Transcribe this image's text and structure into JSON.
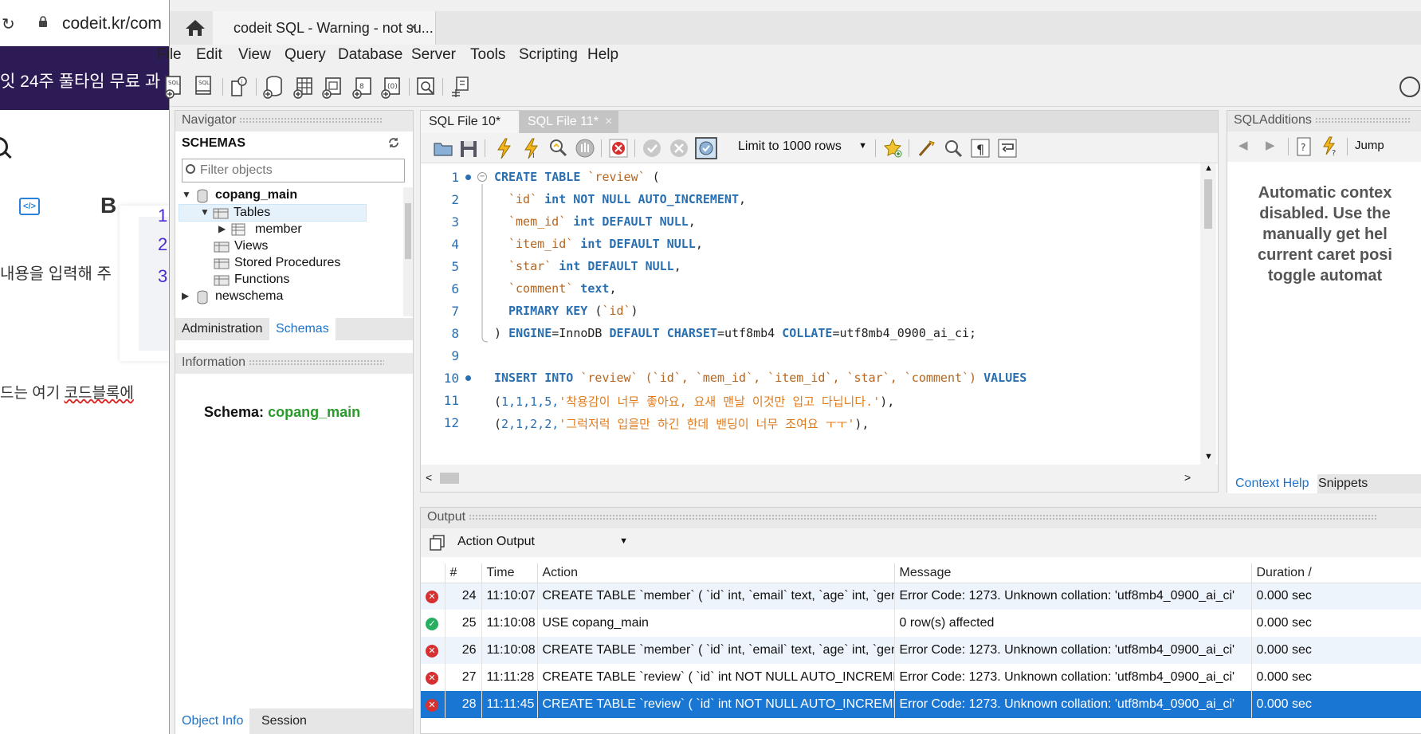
{
  "browser": {
    "url": "codeit.kr/com",
    "banner": "잇 24주 풀타임 무료 과",
    "text1": "내용을 입력해 주",
    "card_numbers": [
      "1",
      "2",
      "3"
    ],
    "text2_plain": "드는 여기 ",
    "text2_underlined": "코드블록에"
  },
  "window": {
    "tab_title": "codeit SQL - Warning - not su...",
    "tab_close": "×"
  },
  "menu": [
    "File",
    "Edit",
    "View",
    "Query",
    "Database",
    "Server",
    "Tools",
    "Scripting",
    "Help"
  ],
  "navigator": {
    "header": "Navigator",
    "schemas_label": "SCHEMAS",
    "filter_placeholder": "Filter objects",
    "tree": {
      "schema1": "copang_main",
      "tables": "Tables",
      "member": "member",
      "views": "Views",
      "procs": "Stored Procedures",
      "funcs": "Functions",
      "schema2": "newschema"
    },
    "tabs": [
      "Administration",
      "Schemas"
    ],
    "info_header": "Information",
    "info_label": "Schema:",
    "info_value": "copang_main",
    "bottom_tabs": [
      "Object Info",
      "Session"
    ]
  },
  "editor": {
    "file_tabs": [
      "SQL File 10*",
      "SQL File 11*"
    ],
    "limit": "Limit to 1000 rows",
    "lines": [
      {
        "n": "1"
      },
      {
        "n": "2"
      },
      {
        "n": "3"
      },
      {
        "n": "4"
      },
      {
        "n": "5"
      },
      {
        "n": "6"
      },
      {
        "n": "7"
      },
      {
        "n": "8"
      },
      {
        "n": "9"
      },
      {
        "n": "10"
      },
      {
        "n": "11"
      },
      {
        "n": "12"
      }
    ],
    "code": {
      "l1_kw": "CREATE TABLE ",
      "l1_id": "`review`",
      "l1_end": " (",
      "l2_id": "`id`",
      "l2_kw": " int NOT NULL AUTO_INCREMENT",
      "l2_end": ",",
      "l3_id": "`mem_id`",
      "l3_kw": " int DEFAULT NULL",
      "l3_end": ",",
      "l4_id": "`item_id`",
      "l4_kw": " int DEFAULT NULL",
      "l4_end": ",",
      "l5_id": "`star`",
      "l5_kw": " int DEFAULT NULL",
      "l5_end": ",",
      "l6_id": "`comment`",
      "l6_kw": " text",
      "l6_end": ",",
      "l7_kw": "PRIMARY KEY ",
      "l7_a": "(",
      "l7_id": "`id`",
      "l7_b": ")",
      "l8_a": ") ",
      "l8_kw1": "ENGINE",
      "l8_b": "=InnoDB ",
      "l8_kw2": "DEFAULT CHARSET",
      "l8_c": "=utf8mb4 ",
      "l8_kw3": "COLLATE",
      "l8_d": "=utf8mb4_0900_ai_ci;",
      "l10_kw": "INSERT INTO ",
      "l10_id": "`review` (`id`, `mem_id`, `item_id`, `star`, `comment`)",
      "l10_kw2": " VALUES",
      "l11_a": "(",
      "l11_nums": "1,1,1,5,",
      "l11_str": "'착용감이 너무 좋아요, 요새 맨날 이것만 입고 다닙니다.'",
      "l11_b": "),",
      "l12_a": "(",
      "l12_nums": "2,1,2,2,",
      "l12_str": "'그럭저럭 입을만 하긴 한데 밴딩이 너무 조여요 ㅜㅜ'",
      "l12_b": "),"
    }
  },
  "additions": {
    "header": "SQLAdditions",
    "jump": "Jump",
    "help_lines": [
      "Automatic contex",
      "disabled. Use the",
      "manually get hel",
      "current caret posi",
      "toggle automat"
    ],
    "tabs": [
      "Context Help",
      "Snippets"
    ]
  },
  "output": {
    "header": "Output",
    "selector": "Action Output",
    "columns": [
      "",
      "#",
      "Time",
      "Action",
      "Message",
      "Duration /"
    ],
    "rows": [
      {
        "status": "error",
        "num": "24",
        "time": "11:10:07",
        "action": "CREATE TABLE `member` (   `id` int,   `email` text,   `age` int,   `gend...",
        "message": "Error Code: 1273. Unknown collation: 'utf8mb4_0900_ai_ci'",
        "duration": "0.000 sec"
      },
      {
        "status": "ok",
        "num": "25",
        "time": "11:10:08",
        "action": "USE copang_main",
        "message": "0 row(s) affected",
        "duration": "0.000 sec"
      },
      {
        "status": "error",
        "num": "26",
        "time": "11:10:08",
        "action": "CREATE TABLE `member` (   `id` int,   `email` text,   `age` int,   `gend...",
        "message": "Error Code: 1273. Unknown collation: 'utf8mb4_0900_ai_ci'",
        "duration": "0.000 sec"
      },
      {
        "status": "error",
        "num": "27",
        "time": "11:11:28",
        "action": "CREATE TABLE `review` (   `id` int NOT NULL AUTO_INCREMEN...",
        "message": "Error Code: 1273. Unknown collation: 'utf8mb4_0900_ai_ci'",
        "duration": "0.000 sec"
      },
      {
        "status": "error",
        "num": "28",
        "time": "11:11:45",
        "action": "CREATE TABLE `review` (   `id` int NOT NULL AUTO_INCREMEN...",
        "message": "Error Code: 1273. Unknown collation: 'utf8mb4_0900_ai_ci'",
        "duration": "0.000 sec"
      }
    ]
  },
  "colors": {
    "keyword": "#2a6fb0",
    "identifier": "#b5651d",
    "string": "#e07a1a",
    "error": "#d63031",
    "ok": "#27ae60",
    "selection": "#1976d2"
  },
  "icons": [
    "home-icon",
    "new-sql-tab-icon",
    "open-sql-icon",
    "inspector-icon",
    "create-schema-icon",
    "create-table-icon",
    "create-view-icon",
    "create-procedure-icon",
    "create-function-icon",
    "search-table-icon",
    "reconnect-icon",
    "open-file-icon",
    "save-icon",
    "execute-icon",
    "execute-current-icon",
    "explain-icon",
    "stop-icon",
    "toggle-error-icon",
    "commit-icon",
    "rollback-icon",
    "autocommit-icon",
    "bookmark-icon",
    "beautify-icon",
    "find-icon",
    "invisible-chars-icon",
    "wrap-icon",
    "user-icon"
  ]
}
